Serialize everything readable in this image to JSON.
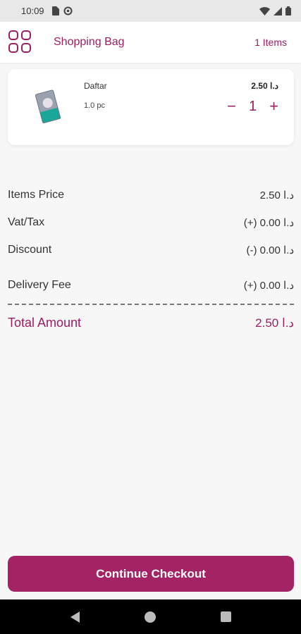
{
  "status_bar": {
    "time": "10:09"
  },
  "header": {
    "title": "Shopping Bag",
    "items_count": "1 Items"
  },
  "cart_items": [
    {
      "name": "Daftar",
      "unit": "1.0 pc",
      "price": "2.50 د.ا",
      "quantity": "1",
      "decrement": "−",
      "increment": "+"
    }
  ],
  "summary": {
    "items_price_label": "Items Price",
    "items_price_value": "2.50 د.ا",
    "vat_label": "Vat/Tax",
    "vat_value": "(+) 0.00 د.ا",
    "discount_label": "Discount",
    "discount_value": "(-) 0.00 د.ا",
    "delivery_label": "Delivery Fee",
    "delivery_value": "(+) 0.00 د.ا",
    "total_label": "Total Amount",
    "total_value": "2.50 د.ا"
  },
  "checkout": {
    "label": "Continue Checkout"
  },
  "colors": {
    "accent": "#9b1f62",
    "button": "#a32365"
  }
}
